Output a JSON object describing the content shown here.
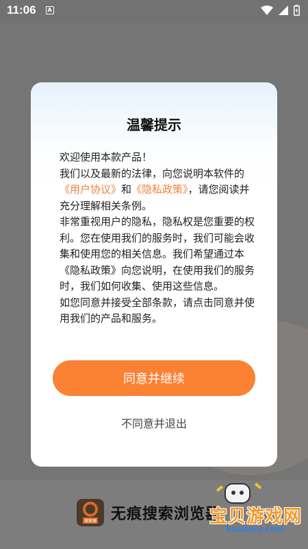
{
  "status_bar": {
    "time": "11:06",
    "notification_glyph": "A",
    "icons": [
      "wifi-icon",
      "cellular-signal-icon",
      "battery-icon"
    ]
  },
  "dialog": {
    "title": "温馨提示",
    "welcome": "欢迎使用本款产品！",
    "paragraph1_prefix": "我们以及最新的法律，向您说明本软件的",
    "user_agreement_link": "《用户协议》",
    "and": "和",
    "privacy_policy_link": "《隐私政策》",
    "paragraph1_suffix": "，请您阅读并充分理解相关条例。",
    "paragraph2": "非常重视用户的隐私，隐私权是您重要的权利。您在使用我们的服务时，我们可能会收集和使用您的相关信息。我们希望通过本《隐私政策》向您说明，在使用我们的服务时，我们如何收集、使用这些信息。",
    "paragraph3": "如您同意并接受全部条款，请点击同意并使用我们的产品和服务。",
    "agree_button": "同意并继续",
    "disagree_button": "不同意并退出"
  },
  "background": {
    "app_name": "无痕搜索浏览器",
    "logo_tag": "搜索器"
  },
  "watermark": {
    "text": "宝贝游戏网",
    "url": "baobeiy.com"
  },
  "colors": {
    "accent": "#fb8133",
    "link": "#f0823a",
    "overlay": "#757575"
  }
}
